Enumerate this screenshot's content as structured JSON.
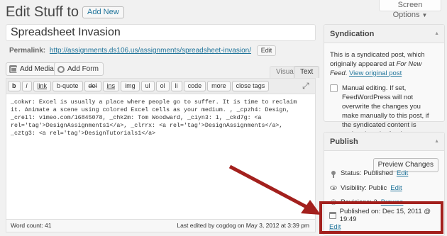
{
  "header": {
    "title": "Edit Stuff to Do",
    "add_new": "Add New",
    "screen_options": "Screen Options"
  },
  "post": {
    "title": "Spreadsheet Invasion",
    "permalink_label": "Permalink:",
    "permalink_url": "http://assignments.ds106.us/assignments/spreadsheet-invasion/",
    "permalink_edit": "Edit"
  },
  "editor": {
    "add_media": "Add Media",
    "add_form": "Add Form",
    "tab_visual": "Visual",
    "tab_text": "Text",
    "quicktags": [
      "b",
      "i",
      "link",
      "b-quote",
      "del",
      "ins",
      "img",
      "ul",
      "ol",
      "li",
      "code",
      "more",
      "close tags"
    ],
    "content": "_cokwr: Excel is usually a place where people go to suffer. It is time to reclaim it. Animate a scene using colored Excel cells as your medium. , _cpzh4: Design, _cre1l: vimeo.com/16845078, _chk2m: Tom Woodward, _ciyn3: 1, _ckd7g: <a rel='tag'>DesignAssignments1</a>, _clrrx: <a rel='tag'>DesignAssignments</a>, _cztg3: <a rel='tag'>DesignTutorials1</a>",
    "word_count": "Word count: 41",
    "last_edited": "Last edited by cogdog on May 3, 2012 at 3:39 pm"
  },
  "syndication": {
    "title": "Syndication",
    "text_before": "This is a syndicated post, which originally appeared at ",
    "source": "For New Feed",
    "text_after": ".",
    "view_original": "View original post",
    "manual_label": "Manual editing. If set, FeedWordPress will not overwrite the changes you make manually to this post, if the syndicated content is updated on the feed."
  },
  "publish": {
    "title": "Publish",
    "preview": "Preview Changes",
    "status_label": "Status: Published",
    "status_edit": "Edit",
    "visibility_label": "Visibility: Public",
    "visibility_edit": "Edit",
    "revisions_label": "Revisions: 2",
    "revisions_browse": "Browse",
    "published_on": "Published on: Dec 15, 2011 @ 19:49",
    "published_edit": "Edit"
  },
  "colors": {
    "highlight": "#a3201d",
    "link": "#21759b"
  }
}
